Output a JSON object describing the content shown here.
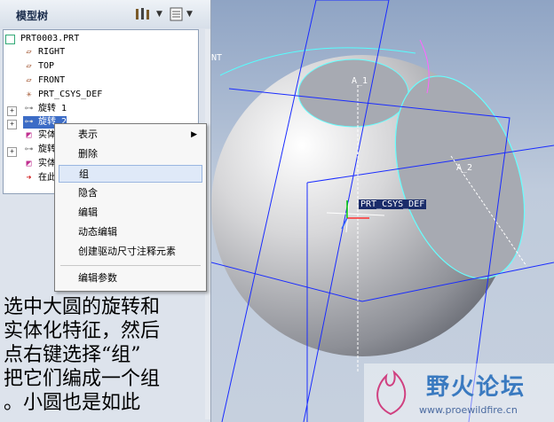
{
  "panel": {
    "title": "模型树"
  },
  "tree": {
    "items": [
      {
        "label": "PRT0003.PRT"
      },
      {
        "label": "RIGHT"
      },
      {
        "label": "TOP"
      },
      {
        "label": "FRONT"
      },
      {
        "label": "PRT_CSYS_DEF"
      },
      {
        "label": "旋转 1"
      },
      {
        "label": "旋转 2"
      },
      {
        "label": "实体"
      },
      {
        "label": "旋转"
      },
      {
        "label": "实体"
      },
      {
        "label": "在此"
      }
    ]
  },
  "context_menu": {
    "items": [
      "表示",
      "删除",
      "组",
      "隐含",
      "编辑",
      "动态编辑",
      "创建驱动尺寸注释元素",
      "编辑参数"
    ],
    "selected": "组"
  },
  "note": {
    "lines": [
      "选中大圆的旋转和",
      "实体化特征，然后",
      "点右键选择“组”",
      "把它们编成一个组",
      "。小圆也是如此"
    ]
  },
  "viewport": {
    "labels": {
      "a1": "A_1",
      "a2": "A_2",
      "csys": "PRT_CSYS_DEF",
      "front": "NT"
    }
  },
  "watermark": {
    "name": "野火论坛",
    "url": "www.proewildfire.cn"
  },
  "colors": {
    "accent": "#1a2cff",
    "highlight": "#00ffff"
  }
}
